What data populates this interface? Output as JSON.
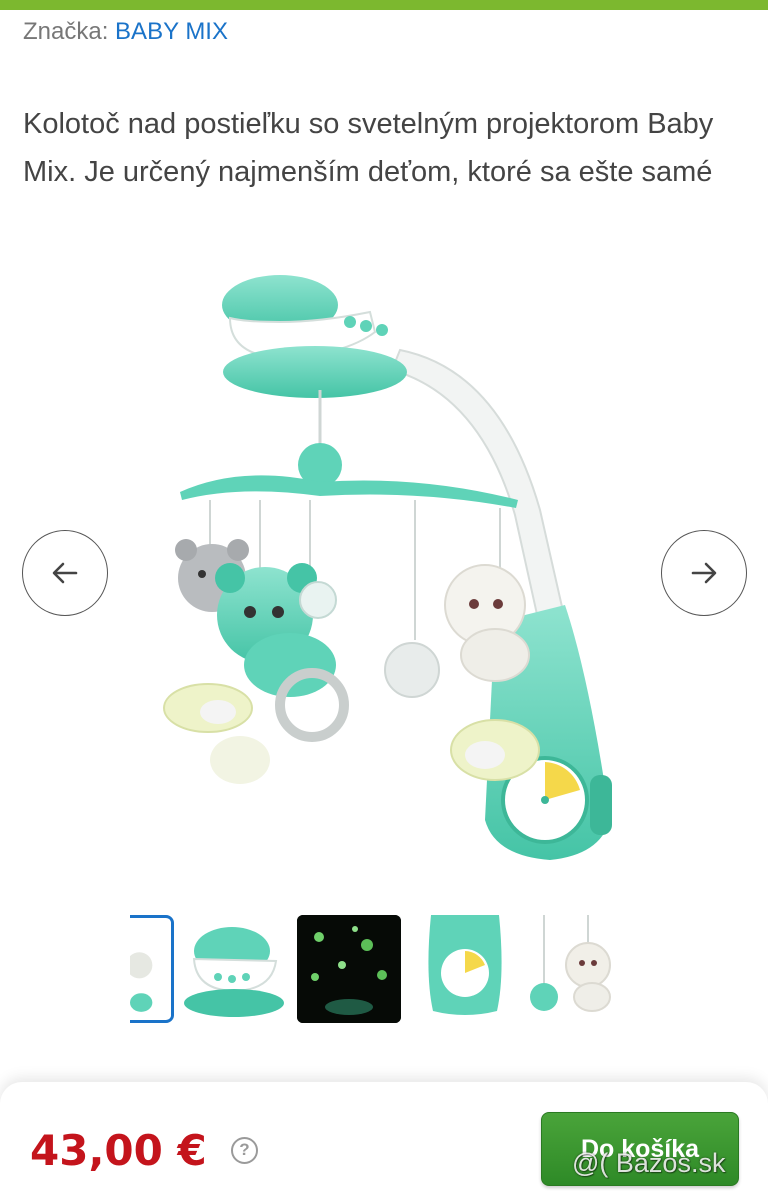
{
  "brand": {
    "label": "Značka:",
    "name": "BABY MIX"
  },
  "description": "Kolotoč nad postieľku so svetelným projektorom Baby Mix. Je určený najmenším deťom, ktoré sa ešte samé",
  "gallery": {
    "prev_icon": "arrow-left-icon",
    "next_icon": "arrow-right-icon",
    "thumbnails": [
      {
        "name": "thumbnail-mobile-detail",
        "selected": true
      },
      {
        "name": "thumbnail-projector",
        "selected": false
      },
      {
        "name": "thumbnail-star-projection",
        "selected": false
      },
      {
        "name": "thumbnail-clock-base",
        "selected": false
      },
      {
        "name": "thumbnail-hanging-toys",
        "selected": false
      }
    ]
  },
  "purchase": {
    "price": "43,00 €",
    "help_icon_glyph": "?",
    "cart_label": "Do košíka"
  },
  "watermark": "@( Bazos.sk",
  "colors": {
    "accent_green": "#7cb82f",
    "link_blue": "#1a73c9",
    "price_red": "#c4141c",
    "button_green": "#3a9a30",
    "toy_mint": "#5fd3b8"
  }
}
